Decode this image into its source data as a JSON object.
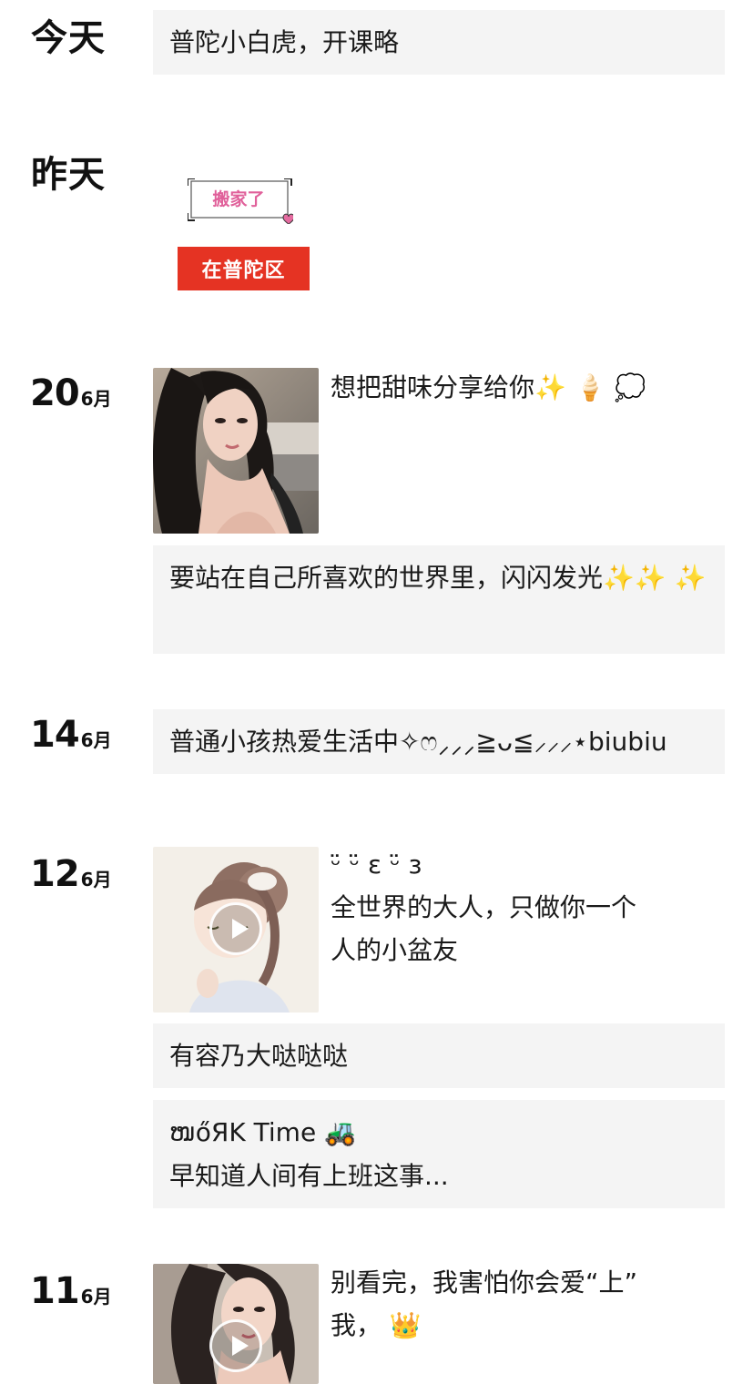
{
  "groups": {
    "today": {
      "label": "今天",
      "post_text": "普陀小白虎，开课略"
    },
    "yesterday": {
      "label": "昨天",
      "sticker_text": "搬家了",
      "banner_text": "在普陀区",
      "banner_color": "#e53323",
      "sticker_text_color": "#e0609a"
    },
    "jun20": {
      "day": "20",
      "month": "6月",
      "photo_caption": "想把甜味分享给你",
      "photo_caption_emoji": "✨ 🍦 💭",
      "text_post": "要站在自己所喜欢的世界里，闪闪发光",
      "text_post_emoji": "✨✨ ✨"
    },
    "jun14": {
      "day": "14",
      "month": "6月",
      "text_post": "普通小孩热爱生活中✧ෆ⸝⸝⸝≧ᴗ≦⸝⸝⸝⋆biubiu"
    },
    "jun12": {
      "day": "12",
      "month": "6月",
      "video_caption_line1": "ᵕ̈ ᵕ̈ ε ᵕ̈ ɜ",
      "video_caption_line2": "全世界的大人，只做你一个",
      "video_caption_line3": "人的小盆友",
      "text_post_1": "有容乃大哒哒哒",
      "text_post_2_line1": "ໜőЯK Time",
      "text_post_2_emoji": "🚜",
      "text_post_2_line2": "早知道人间有上班这事..."
    },
    "jun11": {
      "day": "11",
      "month": "6月",
      "video_caption_line1": "别看完，我害怕你会爱“上”",
      "video_caption_line2": "我，",
      "video_caption_emoji": "👑"
    }
  },
  "colors": {
    "card_background": "#f4f4f4",
    "text": "#1a1a1a"
  }
}
